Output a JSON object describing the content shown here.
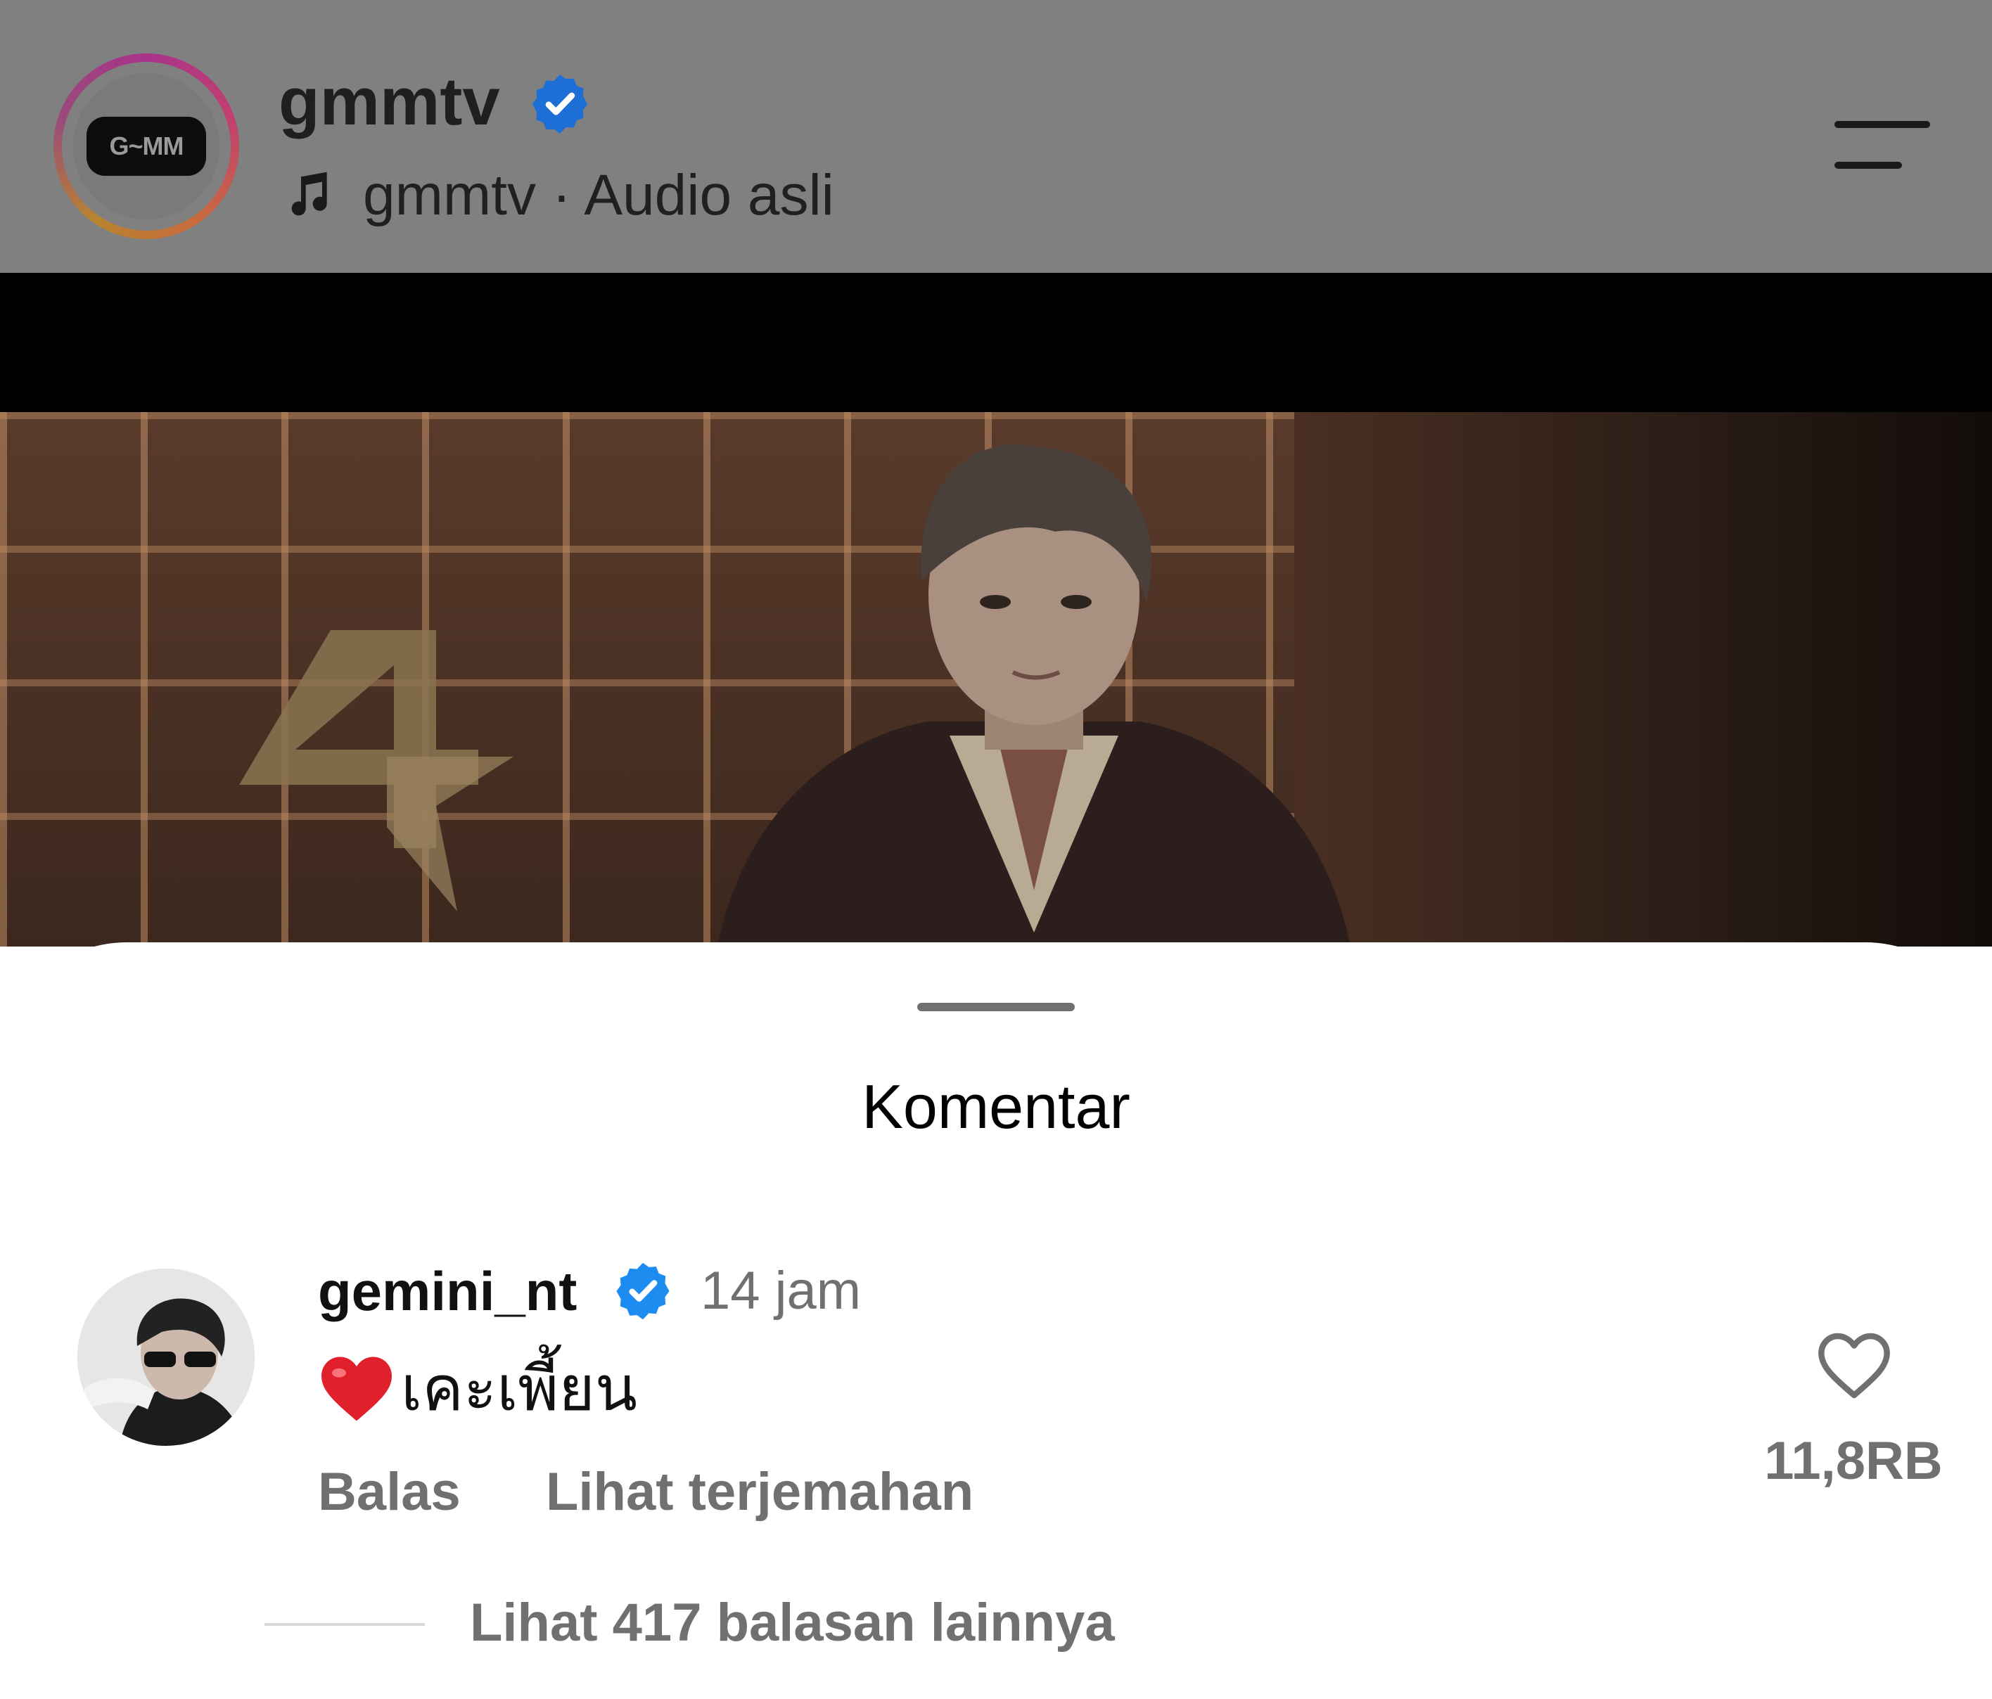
{
  "header": {
    "username": "gmmtv",
    "audio_info": "gmmtv · Audio asli",
    "logo_text": "G~MM"
  },
  "sheet": {
    "title": "Komentar"
  },
  "comment": {
    "username": "gemini_nt",
    "time": "14 jam",
    "text": "เคะเพี้ยน",
    "reply_label": "Balas",
    "translate_label": "Lihat terjemahan",
    "like_count": "11,8RB",
    "view_replies_label": "Lihat 417 balasan lainnya"
  },
  "icons": {
    "verified": "verified-badge-icon",
    "music": "music-note-icon",
    "menu": "menu-icon",
    "like": "heart-outline-icon",
    "emoji": "red-heart-emoji"
  },
  "colors": {
    "verified_blue": "#1d6fd6",
    "secondary_text": "#707070"
  }
}
